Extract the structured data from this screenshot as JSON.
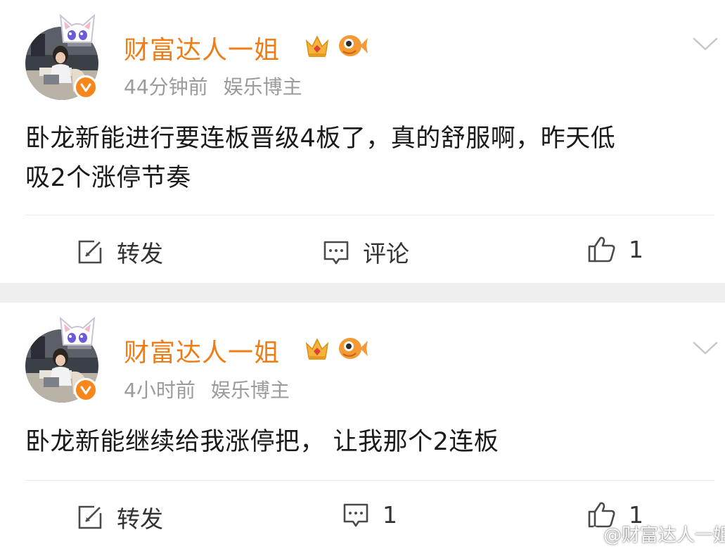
{
  "posts": [
    {
      "author": "财富达人一姐",
      "time": "44分钟前",
      "source": "娱乐博主",
      "content_line1": "卧龙新能进行要连板晋级4板了，真的舒服啊，昨天低",
      "content_line2": "吸2个涨停节奏",
      "repost_label": "转发",
      "comment_label": "评论",
      "like_count": "1"
    },
    {
      "author": "财富达人一姐",
      "time": "4小时前",
      "source": "娱乐博主",
      "content_line1": "卧龙新能继续给我涨停把， 让我那个2连板",
      "repost_label": "转发",
      "comment_count": "1",
      "like_count": "1"
    }
  ],
  "watermark": "@财富达人一姐",
  "colors": {
    "username": "#f07c16",
    "verified_badge": "#f7861c",
    "meta_text": "#9b9b9b",
    "separator": "#efefef"
  },
  "icons": [
    "cat-ear-icon",
    "verified-icon",
    "crown-icon",
    "fish-icon",
    "chevron-down-icon",
    "repost-icon",
    "comment-icon",
    "like-icon",
    "weibo-logo-icon"
  ]
}
